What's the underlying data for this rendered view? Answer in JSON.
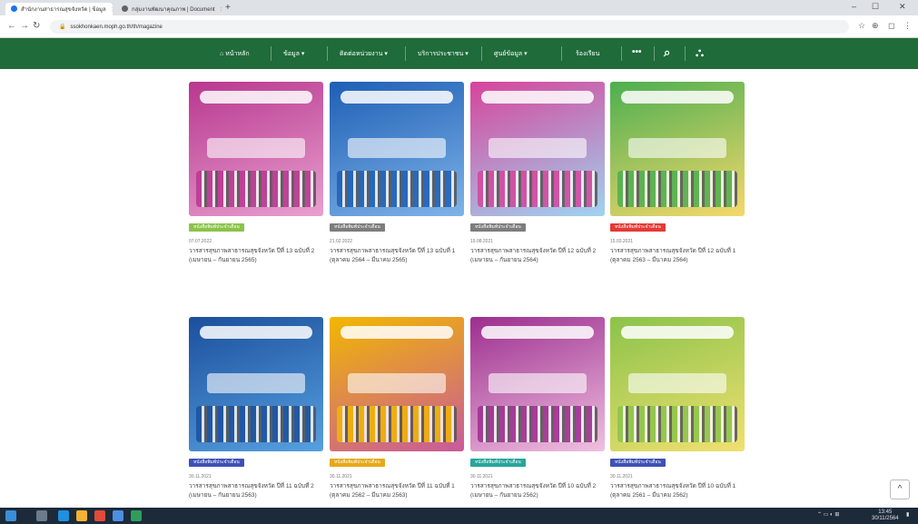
{
  "browser": {
    "tabs": [
      {
        "title": "สำนักงานสาธารณสุขจังหวัด | ข้อมูล",
        "active": true
      },
      {
        "title": "กลุ่มงานพัฒนาคุณภาพ | Document",
        "active": false
      }
    ],
    "new_tab": "+",
    "url": "ssokhonkaen.moph.go.th/th/magazine",
    "window_controls": [
      "–",
      "☐",
      "✕"
    ]
  },
  "nav": {
    "home": "หน้าหลัก",
    "items": [
      "ข้อมูล",
      "ติดต่อหน่วยงาน",
      "บริการประชาชน",
      "ศูนย์ข้อมูล",
      "ร้องเรียน"
    ],
    "more": "•••"
  },
  "cards": [
    {
      "category": "หนังสือพิมพ์ประจำเดือน",
      "cat_color": "#8bc34a",
      "date": "07.07.2022",
      "title": "วารสารสุขภาพสาธารณสุขจังหวัด ปีที่ 13 ฉบับที่ 2 (เมษายน – กันยายน 2565)",
      "bg": [
        "#b8378f",
        "#e8a0cf"
      ]
    },
    {
      "category": "หนังสือพิมพ์ประจำเดือน",
      "cat_color": "#7d7d7d",
      "date": "21.02.2022",
      "title": "วารสารสุขภาพสาธารณสุขจังหวัด ปีที่ 13 ฉบับที่ 1 (ตุลาคม 2564 – มีนาคม 2565)",
      "bg": [
        "#1e5fb5",
        "#7fb3e8"
      ]
    },
    {
      "category": "หนังสือพิมพ์ประจำเดือน",
      "cat_color": "#7d7d7d",
      "date": "19.08.2021",
      "title": "วารสารสุขภาพสาธารณสุขจังหวัด ปีที่ 12 ฉบับที่ 2 (เมษายน – กันยายน 2564)",
      "bg": [
        "#d6449c",
        "#9fd4ef"
      ]
    },
    {
      "category": "หนังสือพิมพ์ประจำเดือน",
      "cat_color": "#e53935",
      "date": "15.03.2021",
      "title": "วารสารสุขภาพสาธารณสุขจังหวัด ปีที่ 12 ฉบับที่ 1 (ตุลาคม 2563 – มีนาคม 2564)",
      "bg": [
        "#4caf50",
        "#f5d86b"
      ]
    },
    {
      "category": "หนังสือพิมพ์ประจำเดือน",
      "cat_color": "#3f51b5",
      "date": "30.11.2021",
      "title": "วารสารสุขภาพสาธารณสุขจังหวัด ปีที่ 11 ฉบับที่ 2 (เมษายน – กันยายน 2563)",
      "bg": [
        "#1b4f9c",
        "#57a0e0"
      ]
    },
    {
      "category": "หนังสือพิมพ์ประจำเดือน",
      "cat_color": "#e6a817",
      "date": "30.11.2021",
      "title": "วารสารสุขภาพสาธารณสุขจังหวัด ปีที่ 11 ฉบับที่ 1 (ตุลาคม 2562 – มีนาคม 2563)",
      "bg": [
        "#f2b700",
        "#c85a9c"
      ]
    },
    {
      "category": "หนังสือพิมพ์ประจำเดือน",
      "cat_color": "#26a69a",
      "date": "30.11.2021",
      "title": "วารสารสุขภาพสาธารณสุขจังหวัด ปีที่ 10 ฉบับที่ 2 (เมษายน – กันยายน 2562)",
      "bg": [
        "#9c2e8f",
        "#f0c0e0"
      ]
    },
    {
      "category": "หนังสือพิมพ์ประจำเดือน",
      "cat_color": "#3f51b5",
      "date": "30.11.2021",
      "title": "วารสารสุขภาพสาธารณสุขจังหวัด ปีที่ 10 ฉบับที่ 1 (ตุลาคม 2561 – มีนาคม 2562)",
      "bg": [
        "#8bc34a",
        "#f0e070"
      ]
    }
  ],
  "scroll_top": "^",
  "taskbar": {
    "time": "13:45",
    "date": "30/11/2564"
  }
}
